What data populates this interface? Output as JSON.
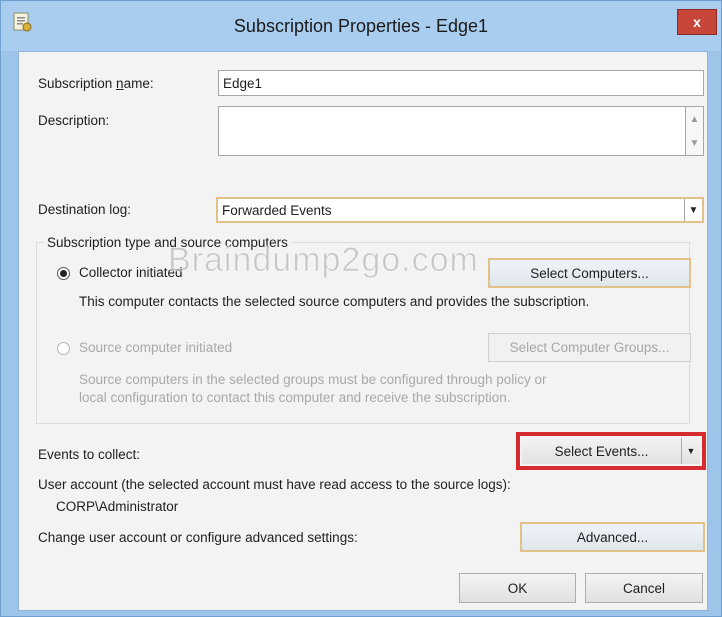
{
  "window": {
    "title": "Subscription Properties - Edge1",
    "close_label": "x"
  },
  "subscription_name": {
    "label": "Subscription name:",
    "label_underline": "n",
    "value": "Edge1"
  },
  "description": {
    "label": "Description:",
    "value": ""
  },
  "destination_log": {
    "label": "Destination log:",
    "value": "Forwarded Events"
  },
  "subscription_type": {
    "group_label": "Subscription type and source computers",
    "collector": {
      "label": "Collector initiated",
      "selected": true,
      "description": "This computer contacts the selected source computers and provides the subscription.",
      "button_label": "Select Computers..."
    },
    "source": {
      "label": "Source computer initiated",
      "selected": false,
      "description_line1": "Source computers in the selected groups must be configured through policy or",
      "description_line2": "local configuration to contact this computer and receive the subscription.",
      "button_label": "Select Computer Groups..."
    }
  },
  "events": {
    "label": "Events to collect:",
    "button_label": "Select Events...",
    "highlight_color": "#d52b2e"
  },
  "user_account": {
    "label": "User account (the selected account must have read access to the source logs):",
    "value": "CORP\\Administrator"
  },
  "advanced": {
    "label": "Change user account or configure advanced settings:",
    "button_label": "Advanced..."
  },
  "footer": {
    "ok_label": "OK",
    "cancel_label": "Cancel"
  },
  "watermark": "Braindump2go.com",
  "colors": {
    "frame": "#9dc4e9",
    "close_button": "#c7463a",
    "client_background": "#f3f3f3"
  }
}
